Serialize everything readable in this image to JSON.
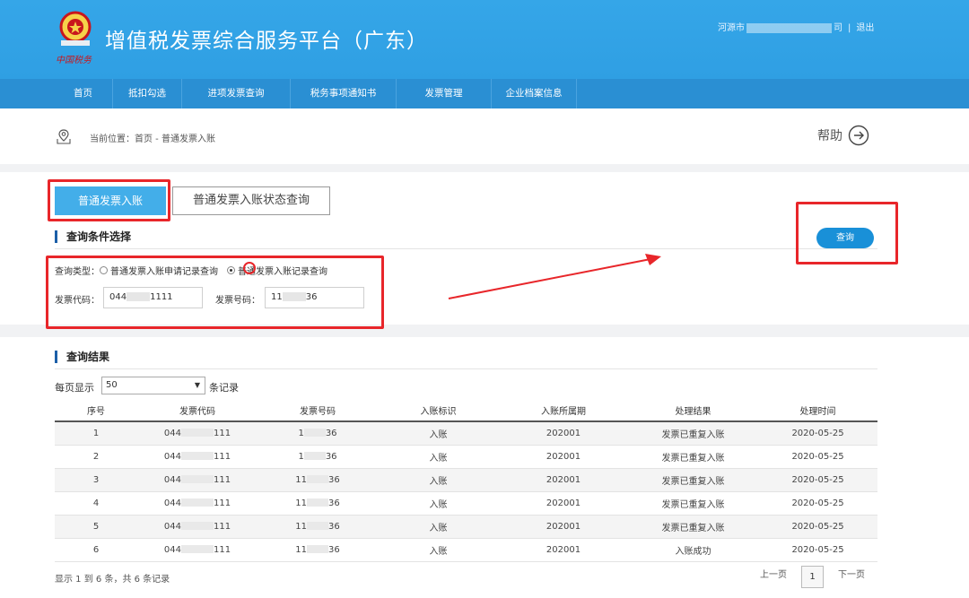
{
  "header": {
    "title": "增值税发票综合服务平台（广东）",
    "emblem_caption": "中国税务",
    "user_prefix": "河源市",
    "user_suffix": "司",
    "logout": "退出"
  },
  "nav": {
    "items": [
      "首页",
      "抵扣勾选",
      "进项发票查询",
      "税务事项通知书",
      "发票管理",
      "企业档案信息"
    ]
  },
  "breadcrumb": {
    "text": "当前位置：首页 - 普通发票入账",
    "help": "帮助"
  },
  "tabs": {
    "active": "普通发票入账",
    "inactive": "普通发票入账状态查询"
  },
  "query": {
    "section_title": "查询条件选择",
    "button": "查询",
    "type_label": "查询类型：",
    "option1": "普通发票入账申请记录查询",
    "option2": "普通发票入账记录查询",
    "selected_option": "普通发票入账记录查询",
    "code_label": "发票代码：",
    "code_prefix": "044",
    "code_suffix": "1111",
    "number_label": "发票号码：",
    "number_prefix": "11",
    "number_suffix": "36"
  },
  "results": {
    "section_title": "查询结果",
    "per_page_label": "每页显示",
    "per_page_value": "50",
    "per_page_suffix": "条记录",
    "columns": [
      "序号",
      "发票代码",
      "发票号码",
      "入账标识",
      "入账所属期",
      "处理结果",
      "处理时间"
    ],
    "rows": [
      {
        "no": "1",
        "code_a": "044",
        "code_b": "111",
        "num_a": "1",
        "num_b": "36",
        "flag": "入账",
        "period": "202001",
        "result": "发票已重复入账",
        "time": "2020-05-25"
      },
      {
        "no": "2",
        "code_a": "044",
        "code_b": "111",
        "num_a": "1",
        "num_b": "36",
        "flag": "入账",
        "period": "202001",
        "result": "发票已重复入账",
        "time": "2020-05-25"
      },
      {
        "no": "3",
        "code_a": "044",
        "code_b": "111",
        "num_a": "11",
        "num_b": "36",
        "flag": "入账",
        "period": "202001",
        "result": "发票已重复入账",
        "time": "2020-05-25"
      },
      {
        "no": "4",
        "code_a": "044",
        "code_b": "111",
        "num_a": "11",
        "num_b": "36",
        "flag": "入账",
        "period": "202001",
        "result": "发票已重复入账",
        "time": "2020-05-25"
      },
      {
        "no": "5",
        "code_a": "044",
        "code_b": "111",
        "num_a": "11",
        "num_b": "36",
        "flag": "入账",
        "period": "202001",
        "result": "发票已重复入账",
        "time": "2020-05-25"
      },
      {
        "no": "6",
        "code_a": "044",
        "code_b": "111",
        "num_a": "11",
        "num_b": "36",
        "flag": "入账",
        "period": "202001",
        "result": "入账成功",
        "time": "2020-05-25"
      }
    ],
    "summary": "显示 1 到 6 条，共 6 条记录",
    "prev": "上一页",
    "page": "1",
    "next": "下一页"
  },
  "colors": {
    "header": "#35a6e8",
    "nav": "#2a8fd3",
    "accent": "#43aee9",
    "annotation": "#e8262a"
  }
}
